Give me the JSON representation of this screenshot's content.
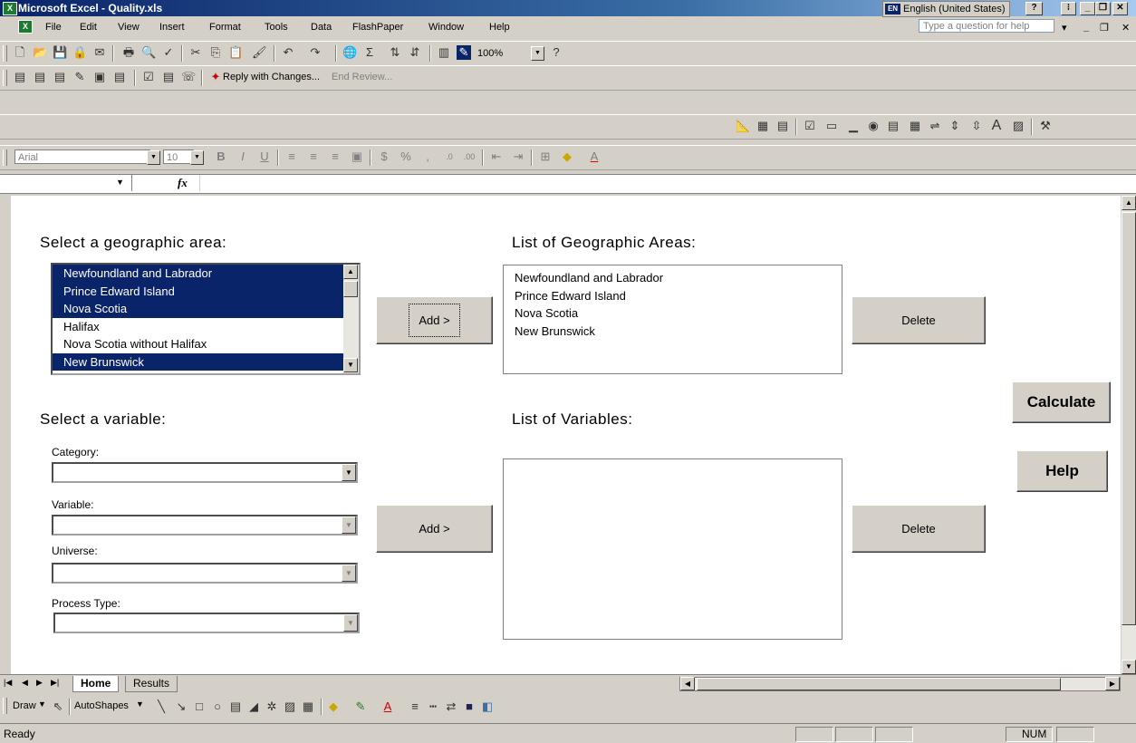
{
  "window": {
    "title": "Microsoft Excel - Quality.xls",
    "language": "English (United States)",
    "lang_code": "EN"
  },
  "menu": {
    "items": [
      "File",
      "Edit",
      "View",
      "Insert",
      "Format",
      "Tools",
      "Data",
      "FlashPaper",
      "Window",
      "Help"
    ],
    "help_placeholder": "Type a question for help"
  },
  "toolbar": {
    "zoom": "100%",
    "reply_with_changes": "Reply with Changes...",
    "end_review": "End Review...",
    "font": "Arial",
    "font_size": "10"
  },
  "formula": {
    "fx": "fx"
  },
  "geo": {
    "heading": "Select a geographic area:",
    "options": [
      {
        "label": "Newfoundland and Labrador",
        "selected": true
      },
      {
        "label": "Prince Edward Island",
        "selected": true
      },
      {
        "label": "Nova Scotia",
        "selected": true
      },
      {
        "label": "Halifax",
        "selected": false
      },
      {
        "label": "Nova Scotia without Halifax",
        "selected": false
      },
      {
        "label": "New Brunswick",
        "selected": true
      }
    ],
    "add_label": "Add >",
    "list_heading": "List of Geographic Areas:",
    "list_items": [
      "Newfoundland and Labrador",
      "Prince Edward Island",
      "Nova Scotia",
      "New Brunswick"
    ],
    "delete_label": "Delete"
  },
  "variable": {
    "heading": "Select a variable:",
    "category_label": "Category:",
    "variable_label": "Variable:",
    "universe_label": "Universe:",
    "process_label": "Process Type:",
    "add_label": "Add >",
    "list_heading": "List of Variables:",
    "delete_label": "Delete"
  },
  "actions": {
    "calculate": "Calculate",
    "help": "Help"
  },
  "tabs": {
    "home": "Home",
    "results": "Results"
  },
  "drawbar": {
    "draw": "Draw",
    "autoshapes": "AutoShapes"
  },
  "status": {
    "ready": "Ready",
    "num": "NUM"
  },
  "colors": {
    "selection": "#0a246a",
    "titlebar": "#0a246a",
    "chrome": "#d4d0c8"
  }
}
